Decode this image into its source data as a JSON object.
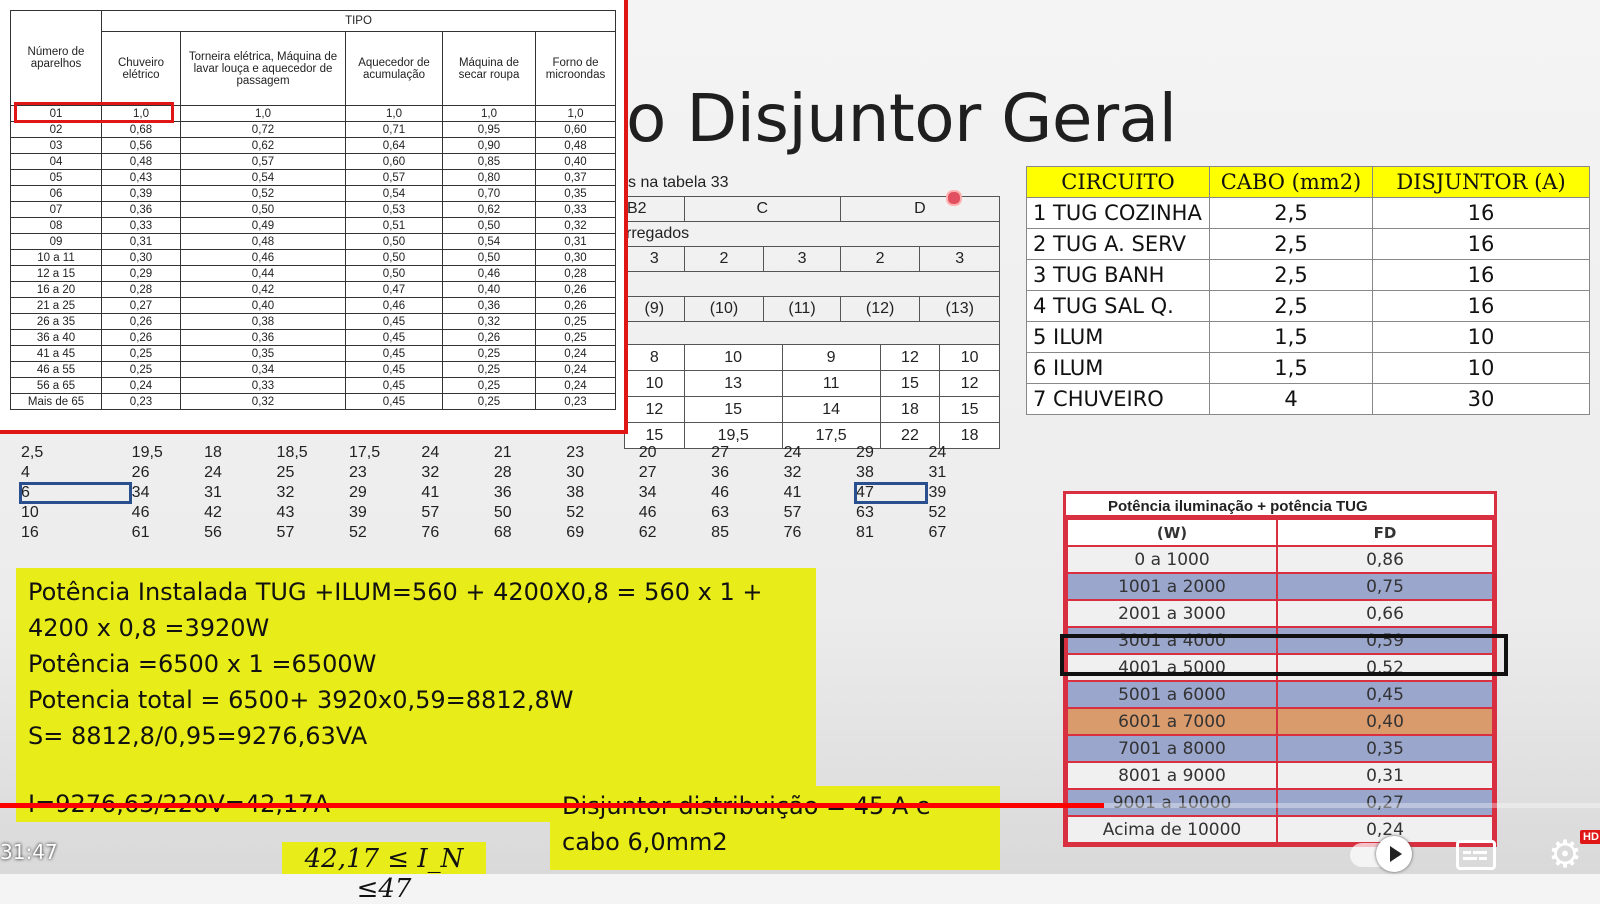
{
  "slide": {
    "title": "o Disjuntor Geral"
  },
  "ampacity_table": {
    "header_note": "s na tabela 33",
    "method_labels": [
      "B2",
      "C",
      "D"
    ],
    "loaded_label": "rregados",
    "conductor_counts": [
      "3",
      "2",
      "3",
      "2",
      "3"
    ],
    "column_numbers": [
      "(9)",
      "(10)",
      "(11)",
      "(12)",
      "(13)"
    ],
    "partial_rows": [
      [
        "8",
        "10",
        "9",
        "12",
        "10"
      ],
      [
        "10",
        "13",
        "11",
        "15",
        "12"
      ],
      [
        "12",
        "15",
        "14",
        "18",
        "15"
      ],
      [
        "15",
        "19,5",
        "17,5",
        "22",
        "18"
      ]
    ],
    "rows": [
      [
        "2,5",
        "19,5",
        "18",
        "18,5",
        "17,5",
        "24",
        "21",
        "23",
        "20",
        "27",
        "24",
        "29",
        "24"
      ],
      [
        "4",
        "26",
        "24",
        "25",
        "23",
        "32",
        "28",
        "30",
        "27",
        "36",
        "32",
        "38",
        "31"
      ],
      [
        "6",
        "34",
        "31",
        "32",
        "29",
        "41",
        "36",
        "38",
        "34",
        "46",
        "41",
        "47",
        "39"
      ],
      [
        "10",
        "46",
        "42",
        "43",
        "39",
        "57",
        "50",
        "52",
        "46",
        "63",
        "57",
        "63",
        "52"
      ],
      [
        "16",
        "61",
        "56",
        "57",
        "52",
        "76",
        "68",
        "69",
        "62",
        "85",
        "76",
        "81",
        "67"
      ]
    ]
  },
  "fd_device_table": {
    "group_header": "TIPO",
    "col_headers": [
      "Número de aparelhos",
      "Chuveiro elétrico",
      "Torneira elétrica, Máquina de lavar louça e aquecedor de passagem",
      "Aquecedor de acumulação",
      "Máquina de secar roupa",
      "Forno de microondas"
    ],
    "rows": [
      [
        "01",
        "1,0",
        "1,0",
        "1,0",
        "1,0",
        "1,0"
      ],
      [
        "02",
        "0,68",
        "0,72",
        "0,71",
        "0,95",
        "0,60"
      ],
      [
        "03",
        "0,56",
        "0,62",
        "0,64",
        "0,90",
        "0,48"
      ],
      [
        "04",
        "0,48",
        "0,57",
        "0,60",
        "0,85",
        "0,40"
      ],
      [
        "05",
        "0,43",
        "0,54",
        "0,57",
        "0,80",
        "0,37"
      ],
      [
        "06",
        "0,39",
        "0,52",
        "0,54",
        "0,70",
        "0,35"
      ],
      [
        "07",
        "0,36",
        "0,50",
        "0,53",
        "0,62",
        "0,33"
      ],
      [
        "08",
        "0,33",
        "0,49",
        "0,51",
        "0,50",
        "0,32"
      ],
      [
        "09",
        "0,31",
        "0,48",
        "0,50",
        "0,54",
        "0,31"
      ],
      [
        "10 a 11",
        "0,30",
        "0,46",
        "0,50",
        "0,50",
        "0,30"
      ],
      [
        "12 a 15",
        "0,29",
        "0,44",
        "0,50",
        "0,46",
        "0,28"
      ],
      [
        "16 a 20",
        "0,28",
        "0,42",
        "0,47",
        "0,40",
        "0,26"
      ],
      [
        "21 a 25",
        "0,27",
        "0,40",
        "0,46",
        "0,36",
        "0,26"
      ],
      [
        "26 a 35",
        "0,26",
        "0,38",
        "0,45",
        "0,32",
        "0,25"
      ],
      [
        "36 a 40",
        "0,26",
        "0,36",
        "0,45",
        "0,26",
        "0,25"
      ],
      [
        "41 a 45",
        "0,25",
        "0,35",
        "0,45",
        "0,25",
        "0,24"
      ],
      [
        "46 a 55",
        "0,25",
        "0,34",
        "0,45",
        "0,25",
        "0,24"
      ],
      [
        "56 a 65",
        "0,24",
        "0,33",
        "0,45",
        "0,25",
        "0,24"
      ],
      [
        "Mais de 65",
        "0,23",
        "0,32",
        "0,45",
        "0,25",
        "0,23"
      ]
    ]
  },
  "circuit_table": {
    "headers": [
      "CIRCUITO",
      "CABO (mm2)",
      "DISJUNTOR (A)"
    ],
    "rows": [
      [
        "1 TUG COZINHA",
        "2,5",
        "16"
      ],
      [
        "2 TUG A. SERV",
        "2,5",
        "16"
      ],
      [
        "3 TUG BANH",
        "2,5",
        "16"
      ],
      [
        "4 TUG SAL Q.",
        "2,5",
        "16"
      ],
      [
        "5 ILUM",
        "1,5",
        "10"
      ],
      [
        "6 ILUM",
        "1,5",
        "10"
      ],
      [
        "7 CHUVEIRO",
        "4",
        "30"
      ]
    ]
  },
  "power_fd_table": {
    "title": "Potência iluminação + potência TUG",
    "headers": [
      "(W)",
      "FD"
    ],
    "rows": [
      [
        "0 a 1000",
        "0,86"
      ],
      [
        "1001 a 2000",
        "0,75"
      ],
      [
        "2001 a 3000",
        "0,66"
      ],
      [
        "3001 a 4000",
        "0,59"
      ],
      [
        "4001 a 5000",
        "0,52"
      ],
      [
        "5001 a 6000",
        "0,45"
      ],
      [
        "6001 a 7000",
        "0,40"
      ],
      [
        "7001 a 8000",
        "0,35"
      ],
      [
        "8001 a 9000",
        "0,31"
      ],
      [
        "9001 a 10000",
        "0,27"
      ],
      [
        "Acima de 10000",
        "0,24"
      ]
    ],
    "row_colors": [
      "plain",
      "blue",
      "plain",
      "blue",
      "plain",
      "blue",
      "orange",
      "blue",
      "plain",
      "blue",
      "plain"
    ],
    "highlighted_row": "3001 a 4000"
  },
  "calculation": {
    "lines": [
      "Potência Instalada TUG +ILUM=560 + 4200X0,8 = 560 x 1 +",
      "4200 x 0,8 =3920W",
      "Potência =6500 x 1 =6500W",
      "Potencia total = 6500+ 3920x0,59=8812,8W",
      "S= 8812,8/0,95=9276,63VA"
    ],
    "current": "I=9276,63/220V=42,17A",
    "distribution": [
      "Disjuntor distribuição = 45 A e",
      "cabo 6,0mm2"
    ],
    "inequality": "42,17 ≤ I_N ≤47"
  },
  "player": {
    "time": "31:47",
    "progress_fraction": 0.69,
    "hd_badge": "HD",
    "colors": {
      "progress": "#ff0000",
      "highlight_yellow": "#e8ec18",
      "accent_red": "#e01515"
    }
  }
}
